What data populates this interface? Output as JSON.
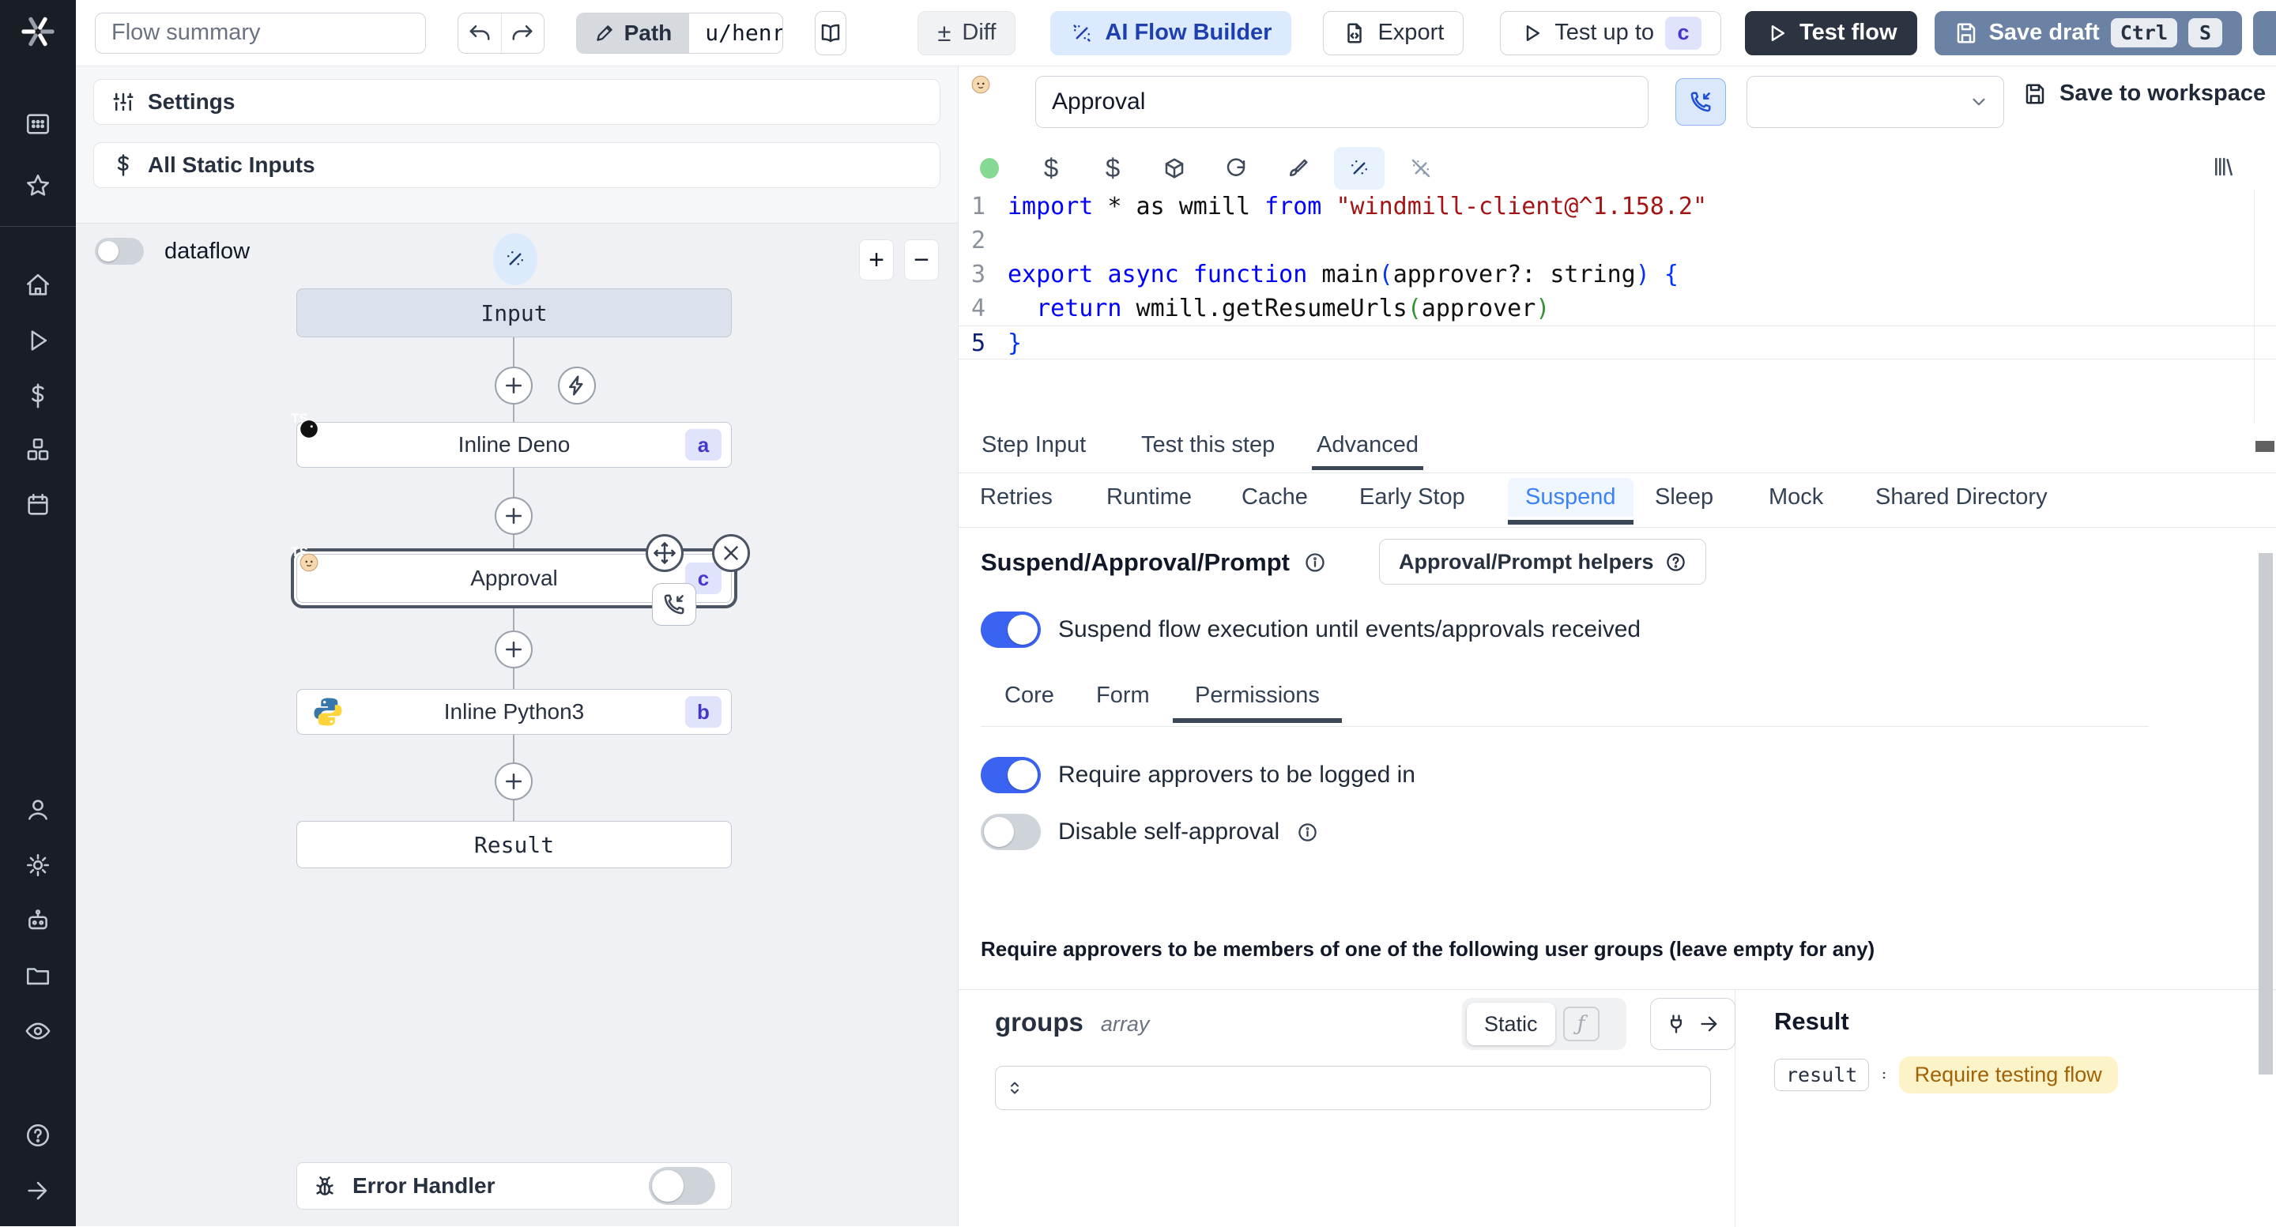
{
  "topbar": {
    "flow_summary_placeholder": "Flow summary",
    "path_label": "Path",
    "path_value": "u/henri/bes",
    "diff_label": "Diff",
    "diff_glyph": "±",
    "ai_flow_builder_label": "AI Flow Builder",
    "export_label": "Export",
    "test_up_to_label": "Test up to",
    "test_up_to_badge": "c",
    "test_flow_label": "Test flow",
    "save_draft_label": "Save draft",
    "kbd_ctrl": "Ctrl",
    "kbd_s": "S"
  },
  "flow_panel": {
    "settings_label": "Settings",
    "all_static_inputs_label": "All Static Inputs",
    "dataflow_label": "dataflow",
    "zoom_in": "+",
    "zoom_out": "−",
    "error_handler_label": "Error Handler"
  },
  "graph": {
    "input_label": "Input",
    "result_label": "Result",
    "nodes": [
      {
        "label": "Inline Deno",
        "badge": "a"
      },
      {
        "label": "Approval",
        "badge": "c"
      },
      {
        "label": "Inline Python3",
        "badge": "b"
      }
    ]
  },
  "step_header": {
    "name_value": "Approval",
    "save_to_workspace_label": "Save to workspace"
  },
  "editor": {
    "lines": [
      {
        "num": "1",
        "s0": "import",
        "s1": " * as wmill ",
        "s2": "from",
        "s3": " ",
        "s4": "\"windmill-client@^1.158.2\""
      },
      {
        "num": "2"
      },
      {
        "num": "3",
        "s0": "export",
        "s1": " ",
        "s2": "async",
        "s3": " ",
        "s4": "function",
        "s5": " main",
        "s6": "(",
        "s7": "approver?: string",
        "s8": ")",
        "s9": " ",
        "s10": "{"
      },
      {
        "num": "4",
        "s0": "  ",
        "s1": "return",
        "s2": " wmill.getResumeUrls",
        "s3": "(",
        "s4": "approver",
        "s5": ")"
      },
      {
        "num": "5",
        "s0": "}"
      }
    ]
  },
  "tabs": {
    "items": [
      {
        "label": "Step Input"
      },
      {
        "label": "Test this step"
      },
      {
        "label": "Advanced"
      }
    ],
    "active": "Advanced"
  },
  "subtabs": {
    "items": [
      {
        "label": "Retries"
      },
      {
        "label": "Runtime"
      },
      {
        "label": "Cache"
      },
      {
        "label": "Early Stop"
      },
      {
        "label": "Suspend"
      },
      {
        "label": "Sleep"
      },
      {
        "label": "Mock"
      },
      {
        "label": "Shared Directory"
      }
    ],
    "active": "Suspend"
  },
  "suspend_section": {
    "title": "Suspend/Approval/Prompt",
    "helpers_button_label": "Approval/Prompt helpers",
    "suspend_toggle_label": "Suspend flow execution until events/approvals received",
    "suspend_toggle_on": true,
    "tabs": [
      {
        "label": "Core"
      },
      {
        "label": "Form"
      },
      {
        "label": "Permissions"
      }
    ],
    "active_tab": "Permissions",
    "require_login_label": "Require approvers to be logged in",
    "require_login_on": true,
    "disable_self_approval_label": "Disable self-approval",
    "disable_self_approval_on": false,
    "groups_note": "Require approvers to be members of one of the following user groups (leave empty for any)"
  },
  "groups_editor": {
    "name": "groups",
    "type": "array",
    "static_label": "Static",
    "fx_glyph": "ƒ"
  },
  "result_panel": {
    "title": "Result",
    "key": "result",
    "value": "Require testing flow"
  },
  "colors": {
    "toggle_on": "#3b63f2",
    "badge_bg": "#dfe3fc",
    "badge_text": "#4338ca",
    "test_flow_bg": "#2b3440",
    "save_draft_bg": "#6c82a5",
    "amber_bg": "#fdf3c8",
    "amber_text": "#a16207",
    "suspend_tab_active": "#3b82f6"
  }
}
